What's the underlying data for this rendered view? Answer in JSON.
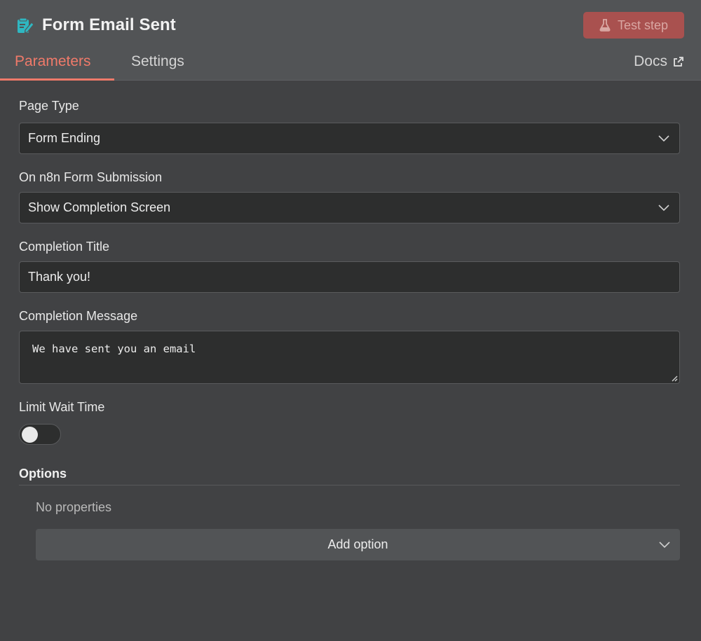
{
  "header": {
    "title": "Form Email Sent",
    "node_icon": "form-edit-icon",
    "test_button": "Test step",
    "test_icon": "flask-icon"
  },
  "tabs": {
    "parameters": "Parameters",
    "settings": "Settings",
    "docs": "Docs",
    "docs_icon": "external-link-icon"
  },
  "fields": {
    "page_type": {
      "label": "Page Type",
      "value": "Form Ending"
    },
    "on_submission": {
      "label": "On n8n Form Submission",
      "value": "Show Completion Screen"
    },
    "completion_title": {
      "label": "Completion Title",
      "value": "Thank you!"
    },
    "completion_message": {
      "label": "Completion Message",
      "value": "We have sent you an email"
    },
    "limit_wait_time": {
      "label": "Limit Wait Time",
      "enabled": false
    }
  },
  "options": {
    "title": "Options",
    "empty_text": "No properties",
    "add_button": "Add option"
  },
  "colors": {
    "accent": "#f07a6a",
    "icon_teal": "#2fb7c1",
    "test_button_bg": "#a9514f"
  }
}
